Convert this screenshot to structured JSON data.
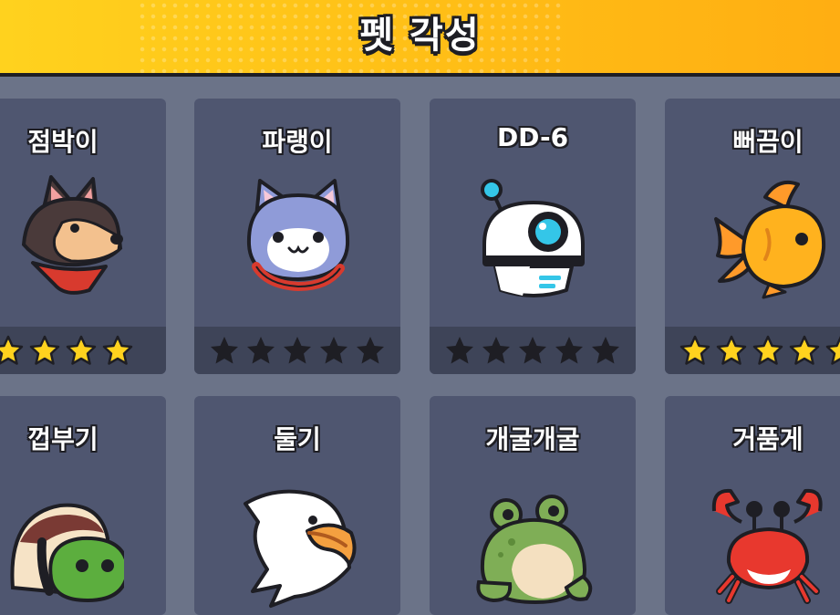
{
  "header": {
    "title": "펫 각성"
  },
  "pets": [
    {
      "name": "점박이",
      "stars": 4,
      "star_color": "#ffd21e",
      "icon": "shiba-dog-icon"
    },
    {
      "name": "파랭이",
      "stars": 5,
      "star_color": "#1e1e24",
      "icon": "blue-cat-icon"
    },
    {
      "name": "DD-6",
      "stars": 5,
      "star_color": "#1e1e24",
      "icon": "robot-icon"
    },
    {
      "name": "뻐끔이",
      "stars": 5,
      "star_color": "#ffd21e",
      "icon": "goldfish-icon"
    },
    {
      "name": "껍부기",
      "icon": "turtle-icon"
    },
    {
      "name": "둘기",
      "icon": "eagle-icon"
    },
    {
      "name": "개굴개굴",
      "icon": "frog-icon"
    },
    {
      "name": "거품게",
      "icon": "crab-icon"
    }
  ],
  "colors": {
    "background": "#6b7388",
    "card": "#4f5670",
    "star_bar": "#3e4458",
    "header_yellow": "#ffc117"
  }
}
